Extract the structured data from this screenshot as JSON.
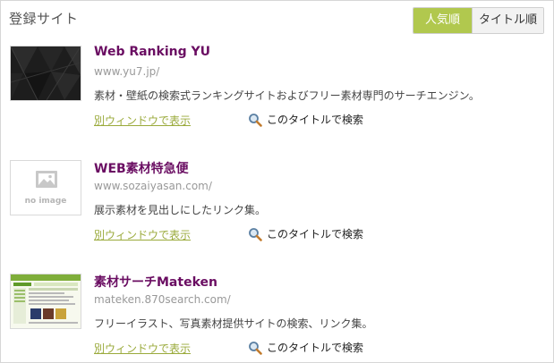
{
  "header": {
    "title": "登録サイト",
    "sort_popular": "人気順",
    "sort_title": "タイトル順"
  },
  "entries": [
    {
      "title": "Web Ranking YU",
      "url": "www.yu7.jp/",
      "description": "素材・壁紙の検索式ランキングサイトおよびフリー素材専門のサーチエンジン。",
      "new_window": "別ウィンドウで表示",
      "search_title": "このタイトルで検索",
      "thumbnail": "dark-pattern-thumbnail"
    },
    {
      "title": "WEB素材特急便",
      "url": "www.sozaiyasan.com/",
      "description": "展示素材を見出しにしたリンク集。",
      "new_window": "別ウィンドウで表示",
      "search_title": "このタイトルで検索",
      "thumbnail": "no-image-placeholder",
      "thumbnail_text": "no image"
    },
    {
      "title": "素材サーチMateken",
      "url": "mateken.870search.com/",
      "description": "フリーイラスト、写真素材提供サイトの検索、リンク集。",
      "new_window": "別ウィンドウで表示",
      "search_title": "このタイトルで検索",
      "thumbnail": "website-screenshot-thumbnail"
    }
  ],
  "colors": {
    "accent_green": "#b1c84e",
    "title_purple": "#6a0d62",
    "link_green": "#9aaa3b"
  }
}
